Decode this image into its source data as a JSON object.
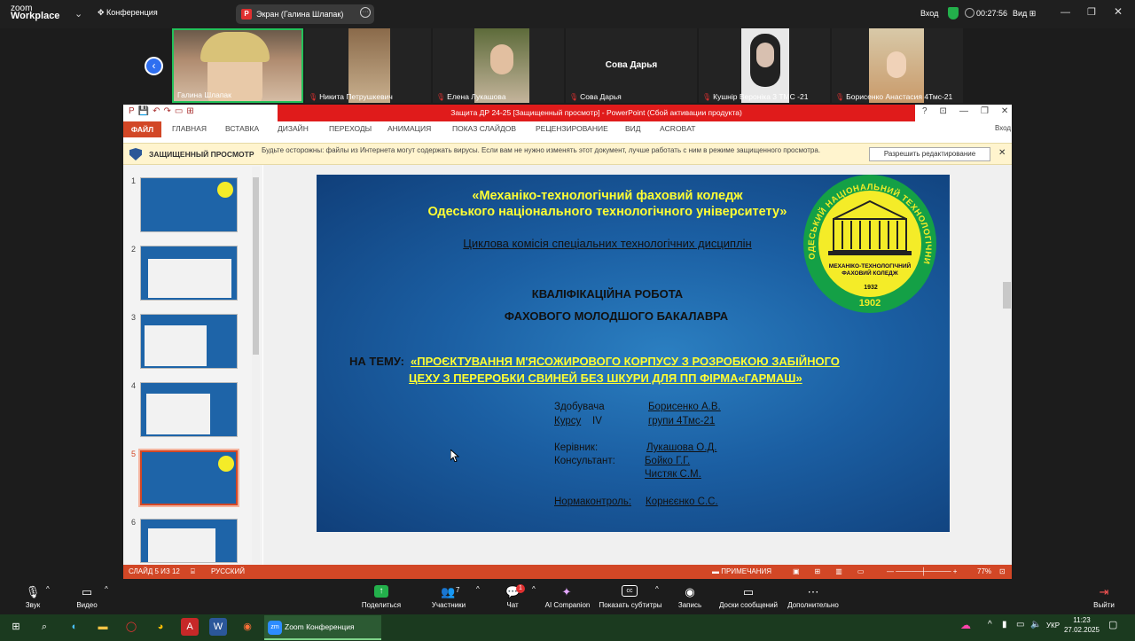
{
  "zoom": {
    "logo_line1": "zoom",
    "logo_line2": "Workplace",
    "meeting_label": "Конференция",
    "share_label": "Экран (Галина Шлапак)",
    "login": "Вход",
    "timer": "00:27:56",
    "view": "Вид"
  },
  "participants": [
    {
      "name": "Галина Шлапак",
      "muted": false
    },
    {
      "name": "Никита Петрушкевич",
      "muted": true
    },
    {
      "name": "Елена Лукашова",
      "muted": true
    },
    {
      "name": "Сова Дарья",
      "muted": true,
      "center_name": "Сова Дарья"
    },
    {
      "name": "Кушнір Вероніка 3 ТМС -21",
      "muted": true
    },
    {
      "name": "Борисенко Анастасия 4Тмс-21",
      "muted": true
    }
  ],
  "ppt": {
    "title": "Защита ДР 24-25 [Защищенный просмотр] - PowerPoint (Сбой активации продукта)",
    "tabs": [
      "ФАЙЛ",
      "ГЛАВНАЯ",
      "ВСТАВКА",
      "ДИЗАЙН",
      "ПЕРЕХОДЫ",
      "АНИМАЦИЯ",
      "ПОКАЗ СЛАЙДОВ",
      "РЕЦЕНЗИРОВАНИЕ",
      "ВИД",
      "ACROBAT"
    ],
    "sign_in": "Вход",
    "protected_label": "ЗАЩИЩЕННЫЙ ПРОСМОТР",
    "protected_text": "Будьте осторожны: файлы из Интернета могут содержать вирусы. Если вам не нужно изменять этот документ, лучше работать с ним в режиме защищенного просмотра.",
    "enable_editing": "Разрешить редактирование",
    "thumb_numbers": [
      "1",
      "2",
      "3",
      "4",
      "5",
      "6"
    ],
    "status_slide": "СЛАЙД 5 ИЗ 12",
    "status_lang": "РУССКИЙ",
    "status_notes": "ПРИМЕЧАНИЯ",
    "zoom_level": "77%"
  },
  "slide": {
    "line1": "«Механіко-технологічний фаховий коледж",
    "line2": "Одеського національного технологічного університету»",
    "line3": "Циклова комісія спеціальних технологічних дисциплін",
    "line4": "КВАЛІФІКАЦІЙНА РОБОТА",
    "line5": "ФАХОВОГО МОЛОДШОГО БАКАЛАВРА",
    "theme_label": "НА ТЕМУ:",
    "theme1": "«ПРОЄКТУВАННЯ М'ЯСОЖИРОВОГО КОРПУСУ З РОЗРОБКОЮ ЗАБІЙНОГО",
    "theme2": "ЦЕХУ З ПЕРЕРОБКИ СВИНЕЙ БЕЗ ШКУРИ ДЛЯ ПП ФІРМА«ГАРМАШ»",
    "student_label": "Здобувача",
    "student_name": "Борисенко А.В.",
    "course_label": "Курсу",
    "course_value": "IV",
    "group": "групи 4Тмс-21",
    "supervisor_label": "Керівник:",
    "supervisor": "Лукашова О.Д.",
    "consultant_label": "Консультант:",
    "consultant1": "Бойко Г.Г.",
    "consultant2": "Чистяк С.М.",
    "norm_label": "Нормаконтроль:",
    "norm": "Корнєєнко С.С.",
    "logo_text": "МЕХАНІКО-ТЕХНОЛОГІЧНИЙ ФАХОВИЙ КОЛЕДЖ",
    "logo_year_small": "1932",
    "logo_year_big": "1902",
    "logo_ring_text": "ОДЕСЬКИЙ НАЦІОНАЛЬНИЙ ТЕХНОЛОГІЧНИЙ УНІВЕРСИТЕТ"
  },
  "toolbar": {
    "audio": "Звук",
    "video": "Видео",
    "share": "Поделиться",
    "participants": "Участники",
    "participants_count": "7",
    "chat": "Чат",
    "chat_badge": "1",
    "ai": "AI Companion",
    "captions": "Показать субтитры",
    "record": "Запись",
    "whiteboard": "Доски сообщений",
    "more": "Дополнительно",
    "leave": "Выйти"
  },
  "taskbar": {
    "zoom_task": "Zoom Конференция",
    "lang": "УКР",
    "time": "11:23",
    "date": "27.02.2025"
  }
}
